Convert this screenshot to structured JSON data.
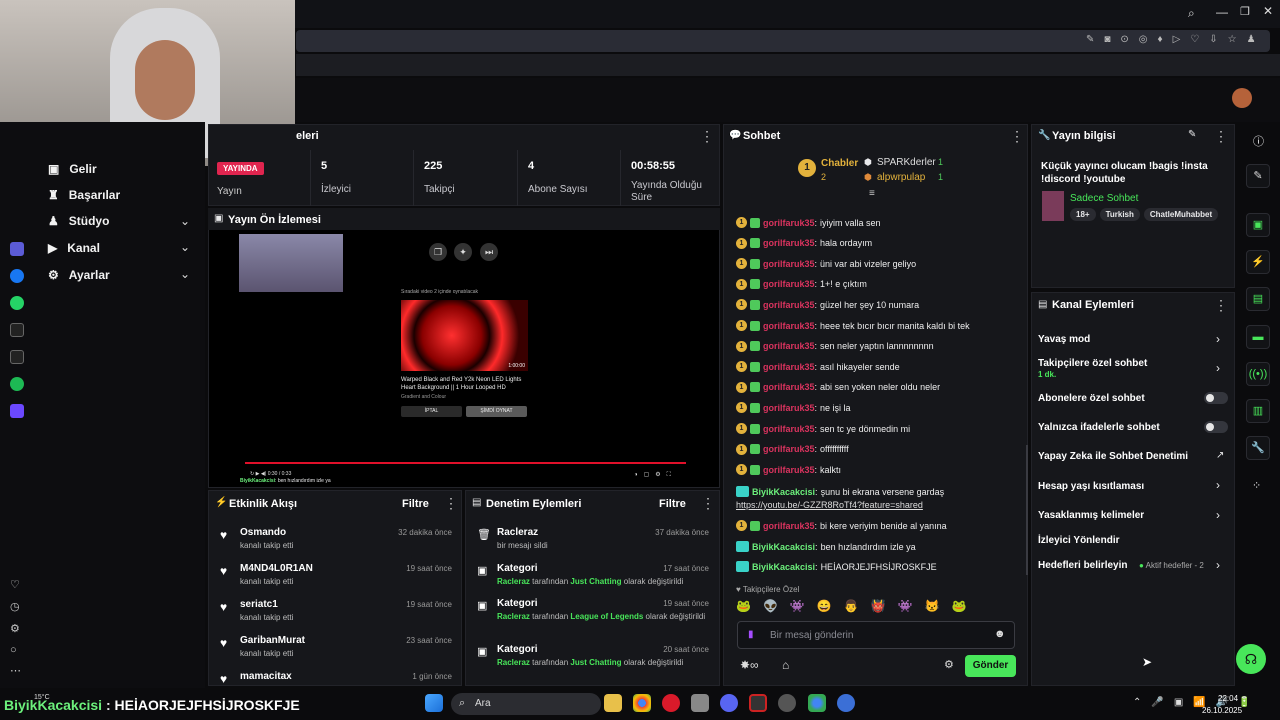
{
  "sidebar": {
    "items": [
      {
        "label": "Gelir"
      },
      {
        "label": "Başarılar"
      },
      {
        "label": "Stüdyo"
      },
      {
        "label": "Kanal"
      },
      {
        "label": "Ayarlar"
      }
    ]
  },
  "stream_info": {
    "header_partial": "eleri",
    "live_badge": "YAYINDA",
    "live_label": "Yayın",
    "stats": [
      {
        "value": "5",
        "label": "İzleyici"
      },
      {
        "value": "225",
        "label": "Takipçi"
      },
      {
        "value": "4",
        "label": "Abone Sayısı"
      },
      {
        "value": "00:58:55",
        "label": "Yayında Olduğu Süre"
      }
    ]
  },
  "preview": {
    "title": "Yayın Ön İzlemesi",
    "next_text": "Sıradaki video 2 içinde oynatılacak",
    "video_title": "Warped Black and Red Y2k Neon LED Lights Heart Background || 1 Hour Looped HD",
    "channel": "Gradient and Colour",
    "duration": "1:00:00",
    "cancel": "İPTAL",
    "play_now": "ŞİMDİ OYNAT",
    "time": "0:30 / 0:33",
    "overlay_user": "BiyikKacakcisi",
    "overlay_msg": "ben hızlandırdım izle ya"
  },
  "activity": {
    "title": "Etkinlik Akışı",
    "filter": "Filtre",
    "events": [
      {
        "name": "Osmando",
        "sub": "kanalı takip etti",
        "time": "32 dakika önce"
      },
      {
        "name": "M4ND4L0R1AN",
        "sub": "kanalı takip etti",
        "time": "19 saat önce"
      },
      {
        "name": "seriatc1",
        "sub": "kanalı takip etti",
        "time": "19 saat önce"
      },
      {
        "name": "GaribanMurat",
        "sub": "kanalı takip etti",
        "time": "23 saat önce"
      },
      {
        "name": "mamacitax",
        "sub": "",
        "time": "1 gün önce"
      }
    ]
  },
  "moderation": {
    "title": "Denetim Eylemleri",
    "filter": "Filtre",
    "events": [
      {
        "name": "Racleraz",
        "sub": "bir mesajı sildi",
        "time": "37 dakika önce"
      },
      {
        "name": "Kategori",
        "who": "Racleraz",
        "mid": " tarafından ",
        "cat": "Just Chatting",
        "end": " olarak değiştirildi",
        "time": "17 saat önce"
      },
      {
        "name": "Kategori",
        "who": "Racleraz",
        "mid": " tarafından ",
        "cat": "League of Legends",
        "end": " olarak değiştirildi",
        "time": "19 saat önce"
      },
      {
        "name": "Kategori",
        "who": "Racleraz",
        "mid": " tarafından ",
        "cat": "Just Chatting",
        "end": " olarak değiştirildi",
        "time": "20 saat önce"
      }
    ]
  },
  "chat": {
    "title": "Sohbet",
    "top": [
      {
        "name": "Chabler",
        "count": "2"
      },
      {
        "name": "SPARKderler",
        "count": "1"
      },
      {
        "name": "alpwrpulap",
        "count": "1"
      }
    ],
    "lines": [
      {
        "u": "gorilfaruk35",
        "m": "iyiyim valla sen"
      },
      {
        "u": "gorilfaruk35",
        "m": "hala ordayım"
      },
      {
        "u": "gorilfaruk35",
        "m": "üni var abi vizeler geliyo"
      },
      {
        "u": "gorilfaruk35",
        "m": "1+! e çıktım"
      },
      {
        "u": "gorilfaruk35",
        "m": "güzel her şey 10 numara"
      },
      {
        "u": "gorilfaruk35",
        "m": "heee tek bıcır bıcır manita kaldı bi tek"
      },
      {
        "u": "gorilfaruk35",
        "m": "sen neler yaptın lannnnnnnn"
      },
      {
        "u": "gorilfaruk35",
        "m": "asıl hikayeler sende"
      },
      {
        "u": "gorilfaruk35",
        "m": "abi sen yoken neler oldu neler"
      },
      {
        "u": "gorilfaruk35",
        "m": "ne işi la"
      },
      {
        "u": "gorilfaruk35",
        "m": "sen tc ye dönmedin mi"
      },
      {
        "u": "gorilfaruk35",
        "m": "offffffffff"
      },
      {
        "u": "gorilfaruk35",
        "m": "kalktı"
      }
    ],
    "link_user": "BiyikKacakcisi",
    "link_msg": "şunu bi ekrana versene gardaş",
    "link": "https://youtu.be/-GZZR8RoTf4?feature=shared",
    "tail": [
      {
        "u": "gorilfaruk35",
        "m": "bi kere veriyim benide al yanına",
        "g": false
      },
      {
        "u": "BiyikKacakcisi",
        "m": "ben hızlandırdım izle ya",
        "g": true
      },
      {
        "u": "BiyikKacakcisi",
        "m": "HEİAORJEJFHSİJROSKFJE",
        "g": true
      }
    ],
    "followers_only": "Takipçilere Özel",
    "placeholder": "Bir mesaj gönderin",
    "send": "Gönder"
  },
  "info": {
    "title": "Yayın bilgisi",
    "text": "Küçük yayıncı olucam !bagis !insta !discord !youtube",
    "category": "Sadece Sohbet",
    "tags": [
      "18+",
      "Turkish",
      "ChatleMuhabbet"
    ]
  },
  "actions": {
    "title": "Kanal Eylemleri",
    "items": [
      "Yavaş mod",
      "Takipçilere özel sohbet",
      "Abonelere özel sohbet",
      "Yalnızca ifadelerle sohbet",
      "Yapay Zeka ile Sohbet Denetimi",
      "Hesap yaşı kısıtlaması",
      "Yasaklanmış kelimeler",
      "İzleyici Yönlendir",
      "Hedefleri belirleyin"
    ],
    "follower_sub": "1 dk.",
    "goals_status": "Aktif hedefler - 2"
  },
  "overlay_bottom": {
    "user": "BiyikKacakcisi",
    "msg": "HEİAORJEJFHSİJROSKFJE",
    "temp": "15°C"
  },
  "taskbar": {
    "search": "Ara",
    "time": "22:04",
    "date": "26.10.2025"
  }
}
